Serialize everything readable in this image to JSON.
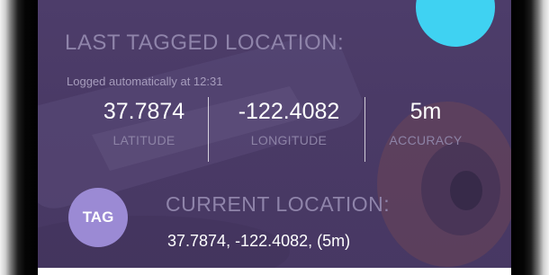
{
  "header": {
    "title": "LAST TAGGED LOCATION:",
    "logged_note": "Logged automatically at 12:31"
  },
  "last_location": {
    "latitude": {
      "value": "37.7874",
      "label": "LATITUDE"
    },
    "longitude": {
      "value": "-122.4082",
      "label": "LONGITUDE"
    },
    "accuracy": {
      "value": "5m",
      "label": "ACCURACY"
    }
  },
  "tag_button": {
    "label": "TAG"
  },
  "current_location": {
    "title": "CURRENT LOCATION:",
    "value": "37.7874, -122.4082, (5m)"
  },
  "colors": {
    "background": "#4a3a66",
    "accent_cyan": "#3fd2f2",
    "tag_button": "#9b8ad4",
    "muted_text": "#8f84aa",
    "value_text": "#ffffff"
  }
}
